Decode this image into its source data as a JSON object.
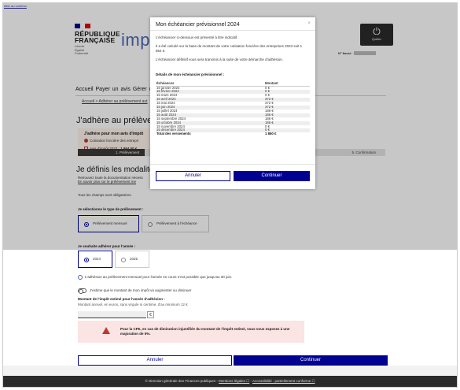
{
  "skip_link": "Aller au contenu",
  "header": {
    "republic_title": "RÉPUBLIQUE FRANÇAISE",
    "motto": "Liberté Égalité Fraternité",
    "brand": "impots",
    "logout_label": "Quitter",
    "fiscal_label": "N° fiscal :",
    "flag_colors": [
      "#000091",
      "#ffffff",
      "#e1000f"
    ]
  },
  "nav": {
    "text": "Accueil   Payer un avis   Gérer un",
    "breadcrumb": "Accueil  >  Adhérer au prélèvement aut"
  },
  "page": {
    "title": "J'adhère au prélèvemer",
    "info_title": "J'adhère pour mon avis d'impôt",
    "info_line1": "Cotisation foncière des entrepri",
    "info_line2_prefix": "Avis d'impôt 2023 :",
    "info_line2_amount": "1 864,00 €",
    "step_active": "1. Prélèvement",
    "step_last": "5. Confirmation",
    "section_title": "Je définis les modalités",
    "doc_line1": "Retrouvez toute la documentation nécess",
    "doc_line2": "En savoir plus sur le prélèvement me",
    "required_note": "Tous les champs sont obligatoires.",
    "type_label": "Je sélectionne le type de prélèvement :",
    "type_monthly": "Prélèvement mensuel",
    "type_due_date": "Prélèvement à l'échéance",
    "year_label": "Je souhaite adhérer pour l'année :",
    "year_2024": "2024",
    "year_2025": "2025",
    "info_monthly": "L'adhésion au prélèvement mensuel pour l'année en cours n'est possible que jusqu'au 30 juin.",
    "toggle_label": "J'estime que le montant de mon impôt va augmenter ou diminuer",
    "amount_label": "Montant de l'impôt estimé pour l'année d'adhésion :",
    "amount_hint": "Montant annuel, en euros, sans virgule ni centime, d'au minimum 12 €",
    "amount_unit": "€",
    "warning": "Pour la CFE, en cas de diminution injustifiée du montant de l'impôt estimé, vous vous exposez à une majoration de 5%.",
    "cancel_label": "Annuler",
    "continue_label": "Continuer"
  },
  "footer": {
    "prefix": "© Direction générale des Finances publiques - ",
    "legal": "Mentions légales ☐",
    "sep": " - ",
    "accessibility": "Accessibilité : partiellement conforme ☐"
  },
  "modal": {
    "title": "Mon échéancier prévisionnel 2024",
    "close": "×",
    "p1": "L'échéancier ci-dessous est présenté à titre indicatif.",
    "p2": "Il a été calculé sur la base du montant de votre cotisation foncière des entreprises 2023 soit 1 864 €.",
    "p3": "L'échéancier définitif vous sera transmis à la suite de votre démarche d'adhésion.",
    "details_title": "Détails de mon échéancier prévisionnel :",
    "col_due": "Échéances",
    "col_amount": "Montant",
    "rows": [
      {
        "date": "15 janvier 2024",
        "amount": "0 €"
      },
      {
        "date": "15 février 2024",
        "amount": "0 €"
      },
      {
        "date": "15 mars 2024",
        "amount": "0 €"
      },
      {
        "date": "15 avril 2024",
        "amount": "372 €"
      },
      {
        "date": "15 mai 2024",
        "amount": "372 €"
      },
      {
        "date": "15 juin 2024",
        "amount": "372 €"
      },
      {
        "date": "15 juillet 2024",
        "amount": "186 €"
      },
      {
        "date": "15 août 2024",
        "amount": "186 €"
      },
      {
        "date": "15 septembre 2024",
        "amount": "186 €"
      },
      {
        "date": "15 octobre 2024",
        "amount": "186 €"
      },
      {
        "date": "15 novembre 2024",
        "amount": "0 €"
      },
      {
        "date": "15 décembre 2024",
        "amount": "0 €"
      }
    ],
    "total_label": "Total des versements",
    "total_amount": "1 860 €",
    "cancel_label": "Annuler",
    "continue_label": "Continuer"
  }
}
